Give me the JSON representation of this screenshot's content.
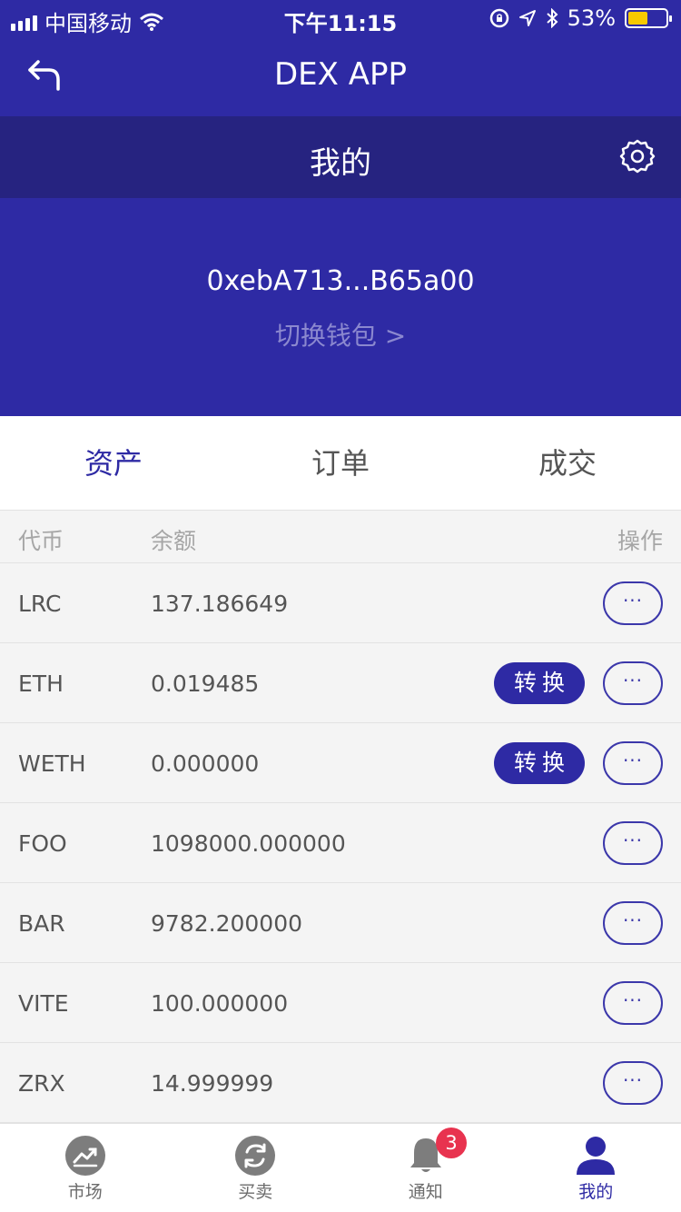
{
  "status_bar": {
    "carrier": "中国移动",
    "time": "下午11:15",
    "battery": "53%",
    "battery_level": 0.53
  },
  "header": {
    "title": "DEX APP"
  },
  "subheader": {
    "title": "我的"
  },
  "wallet": {
    "address": "0xebA713...B65a00",
    "switch_label": "切换钱包 >"
  },
  "tabs": [
    {
      "label": "资产"
    },
    {
      "label": "订单"
    },
    {
      "label": "成交"
    }
  ],
  "table": {
    "headers": {
      "token": "代币",
      "balance": "余额",
      "action": "操作"
    },
    "convert_label": "转换",
    "more_label": "···",
    "rows": [
      {
        "token": "LRC",
        "balance": "137.186649"
      },
      {
        "token": "ETH",
        "balance": "0.019485"
      },
      {
        "token": "WETH",
        "balance": "0.000000"
      },
      {
        "token": "FOO",
        "balance": "1098000.000000"
      },
      {
        "token": "BAR",
        "balance": "9782.200000"
      },
      {
        "token": "VITE",
        "balance": "100.000000"
      },
      {
        "token": "ZRX",
        "balance": "14.999999"
      }
    ]
  },
  "tabbar": {
    "items": [
      {
        "label": "市场",
        "icon": "trend-chart-icon"
      },
      {
        "label": "买卖",
        "icon": "exchange-icon"
      },
      {
        "label": "通知",
        "icon": "bell-icon",
        "badge": "3"
      },
      {
        "label": "我的",
        "icon": "user-icon"
      }
    ]
  },
  "colors": {
    "primary": "#2e2aa4",
    "primary_dark": "#262380",
    "badge": "#e8334f",
    "battery": "#f7c900"
  }
}
